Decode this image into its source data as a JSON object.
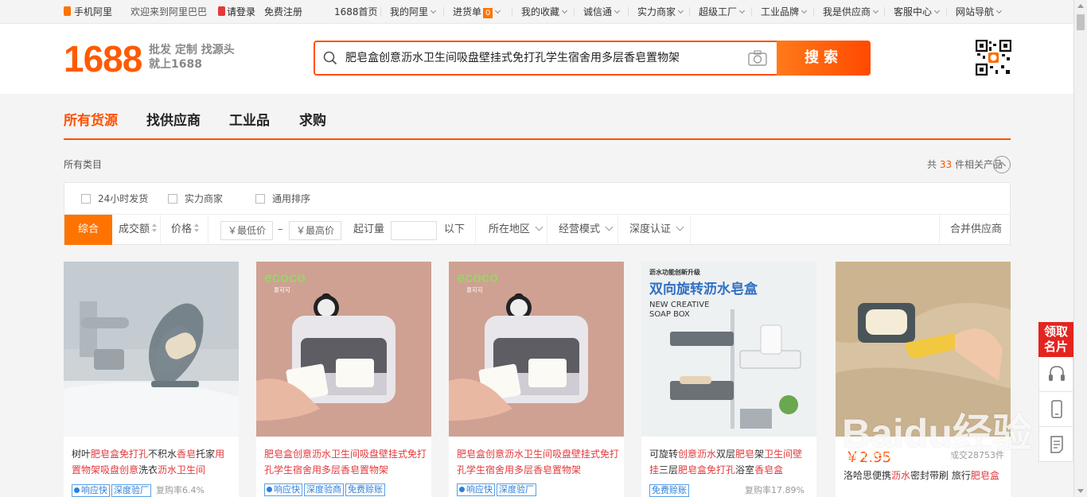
{
  "topbar": {
    "mobile": "手机阿里",
    "welcome": "欢迎来到阿里巴巴",
    "login": "请登录",
    "register": "免费注册",
    "links": [
      {
        "label": "1688首页"
      },
      {
        "label": "我的阿里"
      },
      {
        "label": "进货单",
        "badge": "0"
      },
      {
        "label": "我的收藏"
      },
      {
        "label": "诚信通"
      },
      {
        "label": "实力商家"
      },
      {
        "label": "超级工厂"
      },
      {
        "label": "工业品牌"
      },
      {
        "label": "我是供应商"
      },
      {
        "label": "客服中心"
      },
      {
        "label": "网站导航"
      }
    ]
  },
  "header": {
    "logo": "1688",
    "slogan_line1": "批发 定制 找源头",
    "slogan_line2": "就上1688",
    "search_query": "肥皂盒创意沥水卫生间吸盘壁挂式免打孔学生宿舍用多层香皂置物架",
    "search_button": "搜索"
  },
  "tabs": [
    "所有货源",
    "找供应商",
    "工业品",
    "求购"
  ],
  "breadcrumb": "所有类目",
  "results": {
    "prefix": "共",
    "count": "33",
    "suffix": "件相关产品"
  },
  "filters": {
    "checkboxes": [
      "24小时发货",
      "实力商家",
      "通用排序"
    ],
    "sort": {
      "general": "综合",
      "volume": "成交额",
      "price": "价格",
      "min_price_placeholder": "￥最低价",
      "max_price_placeholder": "￥最高价",
      "dash": "–",
      "moq_label": "起订量",
      "moq_suffix": "以下",
      "region": "所在地区",
      "mode": "经营模式",
      "cert": "深度认证",
      "merge": "合并供应商"
    }
  },
  "products": [
    {
      "title_parts": [
        {
          "text": "树叶",
          "hl": false
        },
        {
          "text": "肥皂盒免打孔",
          "hl": true
        },
        {
          "text": "不积水",
          "hl": false
        },
        {
          "text": "香皂",
          "hl": true
        },
        {
          "text": "托家",
          "hl": false
        },
        {
          "text": "用置物架吸盘创意",
          "hl": true
        },
        {
          "text": "洗衣",
          "hl": false
        },
        {
          "text": "沥水卫生间",
          "hl": true
        }
      ],
      "tags": [
        "响应快",
        "深度验厂"
      ],
      "rate": "复购率6.4%"
    },
    {
      "title_parts": [
        {
          "text": "肥皂盒创意沥水卫生间吸盘壁挂式免打孔学生宿舍用多层香皂置物架",
          "hl": true
        }
      ],
      "tags": [
        "响应快",
        "深度验商",
        "免费赊账"
      ],
      "rate": ""
    },
    {
      "title_parts": [
        {
          "text": "肥皂盒创意沥水卫生间吸盘壁挂式免打孔学生宿舍用多层香皂置物架",
          "hl": true
        }
      ],
      "tags": [
        "响应快",
        "深度验厂"
      ],
      "rate": ""
    },
    {
      "title_parts": [
        {
          "text": "可旋转",
          "hl": false
        },
        {
          "text": "创意沥水",
          "hl": true
        },
        {
          "text": "双层",
          "hl": false
        },
        {
          "text": "肥皂",
          "hl": true
        },
        {
          "text": "架",
          "hl": false
        },
        {
          "text": "卫生间壁挂",
          "hl": true
        },
        {
          "text": "三层",
          "hl": false
        },
        {
          "text": "肥皂盒免打孔",
          "hl": true
        },
        {
          "text": "浴室",
          "hl": false
        },
        {
          "text": "香皂盒",
          "hl": true
        }
      ],
      "tags": [
        "免费赊账"
      ],
      "rate": "复购率17.89%",
      "image_text_1": "沥水功能创新升级",
      "image_text_2": "双向旋转沥水皂盒",
      "image_text_3": "NEW CREATIVE",
      "image_text_4": "SOAP BOX"
    },
    {
      "price": "￥2.95",
      "sold": "成交28753件",
      "title_parts": [
        {
          "text": "洛哈思便携",
          "hl": false
        },
        {
          "text": "沥水",
          "hl": true
        },
        {
          "text": "密封带刷 旅行",
          "hl": false
        },
        {
          "text": "肥皂盒",
          "hl": true
        }
      ]
    }
  ],
  "brand_label": "ecoco",
  "brand_sub": "意可可",
  "side": {
    "promo_line1": "领取",
    "promo_line2": "名片"
  },
  "watermark": {
    "text": "Baidu经验",
    "url": "jingyan.baidu.com"
  },
  "colors": {
    "accent": "#ff5000",
    "highlight": "#e4393c",
    "tag": "#2f7ed8"
  }
}
